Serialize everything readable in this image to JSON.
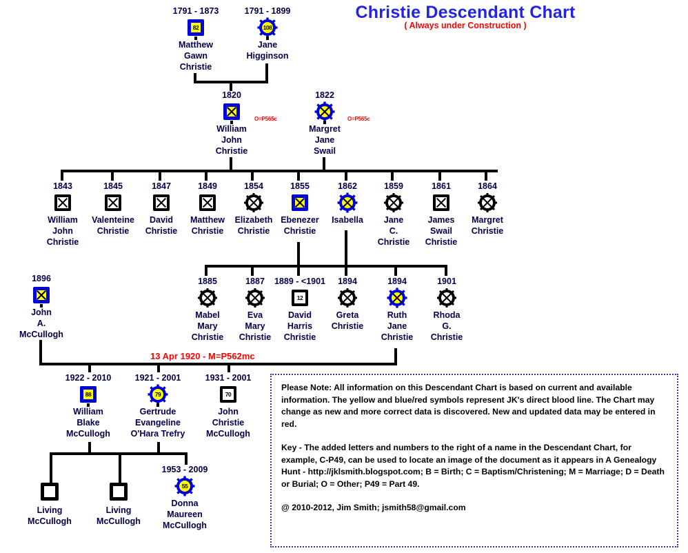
{
  "title": "Christie Descendant Chart",
  "subtitle": "( Always under Construction )",
  "generations": {
    "g1": [
      {
        "id": "matthew-gawn-christie",
        "years": "1791 - 1873",
        "name_lines": [
          "Matthew",
          "Gawn",
          "Christie"
        ],
        "symbol": "square-blue-yellow",
        "badge": "82"
      },
      {
        "id": "jane-higginson",
        "years": "1791 - 1899",
        "name_lines": [
          "Jane",
          "Higginson"
        ],
        "symbol": "circle-blue-yellow-spiked",
        "badge": "108"
      }
    ],
    "g2": [
      {
        "id": "william-john-christie",
        "years": "1820",
        "name_lines": [
          "William",
          "John",
          "Christie"
        ],
        "symbol": "square-blue-yellow-x",
        "badge": "",
        "tag": "O=P565c"
      },
      {
        "id": "margret-jane-swail",
        "years": "1822",
        "name_lines": [
          "Margret",
          "Jane",
          "Swail"
        ],
        "symbol": "circle-blue-yellow-spiked-x",
        "badge": "",
        "tag": "O=P565c"
      }
    ],
    "g3": [
      {
        "id": "william-john-christie-2",
        "years": "1843",
        "name_lines": [
          "William",
          "John",
          "Christie"
        ],
        "symbol": "square-black-x",
        "badge": ""
      },
      {
        "id": "valenteine-christie",
        "years": "1845",
        "name_lines": [
          "Valenteine",
          "Christie"
        ],
        "symbol": "square-black-x",
        "badge": ""
      },
      {
        "id": "david-christie",
        "years": "1847",
        "name_lines": [
          "David",
          "Christie"
        ],
        "symbol": "square-black-x",
        "badge": ""
      },
      {
        "id": "matthew-christie",
        "years": "1849",
        "name_lines": [
          "Matthew",
          "Christie"
        ],
        "symbol": "square-black-x",
        "badge": ""
      },
      {
        "id": "elizabeth-christie",
        "years": "1854",
        "name_lines": [
          "Elizabeth",
          "Christie"
        ],
        "symbol": "circle-black-spiked-x",
        "badge": ""
      },
      {
        "id": "ebenezer-christie",
        "years": "1855",
        "name_lines": [
          "Ebenezer",
          "Christie"
        ],
        "symbol": "square-blue-yellow-x",
        "badge": ""
      },
      {
        "id": "isabella",
        "years": "1862",
        "name_lines": [
          "Isabella"
        ],
        "symbol": "circle-blue-yellow-spiked-x",
        "badge": ""
      },
      {
        "id": "jane-c-christie",
        "years": "1859",
        "name_lines": [
          "Jane",
          "C.",
          "Christie"
        ],
        "symbol": "circle-black-spiked-x",
        "badge": ""
      },
      {
        "id": "james-swail-christie",
        "years": "1861",
        "name_lines": [
          "James",
          "Swail",
          "Christie"
        ],
        "symbol": "square-black-x",
        "badge": ""
      },
      {
        "id": "margret-christie",
        "years": "1864",
        "name_lines": [
          "Margret",
          "Christie"
        ],
        "symbol": "circle-black-spiked-x",
        "badge": ""
      }
    ],
    "g4": [
      {
        "id": "mabel-mary-christie",
        "years": "1885",
        "name_lines": [
          "Mabel",
          "Mary",
          "Christie"
        ],
        "symbol": "circle-black-spiked-x",
        "badge": ""
      },
      {
        "id": "eva-mary-christie",
        "years": "1887",
        "name_lines": [
          "Eva",
          "Mary",
          "Christie"
        ],
        "symbol": "circle-black-spiked-x",
        "badge": ""
      },
      {
        "id": "david-harris-christie",
        "years": "1889 - <1901",
        "name_lines": [
          "David",
          "Harris",
          "Christie"
        ],
        "symbol": "square-black-num",
        "badge": "12"
      },
      {
        "id": "greta-christie",
        "years": "1894",
        "name_lines": [
          "Greta",
          "Christie"
        ],
        "symbol": "circle-black-spiked-x",
        "badge": ""
      },
      {
        "id": "ruth-jane-christie",
        "years": "1894",
        "name_lines": [
          "Ruth",
          "Jane",
          "Christie"
        ],
        "symbol": "circle-blue-yellow-spiked-x",
        "badge": ""
      },
      {
        "id": "rhoda-g-christie",
        "years": "1901",
        "name_lines": [
          "Rhoda",
          "G.",
          "Christie"
        ],
        "symbol": "circle-black-spiked-x",
        "badge": ""
      }
    ],
    "spouse": {
      "id": "john-a-mccullogh",
      "years": "1896",
      "name_lines": [
        "John",
        "A.",
        "McCullogh"
      ],
      "symbol": "square-blue-yellow-x",
      "badge": ""
    },
    "marriage_note": "13 Apr 1920 - M=P562mc",
    "g5": [
      {
        "id": "william-blake-mccullogh",
        "years": "1922 - 2010",
        "name_lines": [
          "William",
          "Blake",
          "McCullogh"
        ],
        "symbol": "square-blue-yellow-num",
        "badge": "88"
      },
      {
        "id": "gertrude-evangeline-ohara-trefry",
        "years": "1921 - 2001",
        "name_lines": [
          "Gertrude",
          "Evangeline",
          "O'Hara Trefry"
        ],
        "symbol": "circle-blue-yellow-spiked-num",
        "badge": "79"
      },
      {
        "id": "john-christie-mccullogh",
        "years": "1931 - 2001",
        "name_lines": [
          "John",
          "Christie",
          "McCullogh"
        ],
        "symbol": "square-black-num",
        "badge": "70"
      }
    ],
    "g6": [
      {
        "id": "living-mccullogh-1",
        "years": "",
        "name_lines": [
          "Living",
          "McCullogh"
        ],
        "symbol": "square-black-plain",
        "badge": ""
      },
      {
        "id": "living-mccullogh-2",
        "years": "",
        "name_lines": [
          "Living",
          "McCullogh"
        ],
        "symbol": "square-black-plain",
        "badge": ""
      },
      {
        "id": "donna-maureen-mccullogh",
        "years": "1953 - 2009",
        "name_lines": [
          "Donna",
          "Maureen",
          "McCullogh"
        ],
        "symbol": "circle-blue-yellow-spiked-num",
        "badge": "55"
      }
    ]
  },
  "note_box": {
    "paragraph1": "Please Note: All information on this Descendant Chart is based on current and available information. The yellow and blue/red symbols represent JK's direct blood line.  The Chart may change as new and more correct data is discovered. New and updated data may be entered in red.",
    "paragraph2": "Key - The added letters and numbers to the right of a name in the Descendant Chart, for example, C-P49, can be used to locate an image of the document as  it appears in A Genealogy Hunt - http://jklsmith.blogspot.com; B = Birth; C = Baptism/Christening; M = Marriage; D = Death or Burial;  O = Other; P49 = Part 49.",
    "credit": "@ 2010-2012, Jim Smith; jsmith58@gmail.com"
  },
  "colors": {
    "title_blue": "#2323e6",
    "red": "#ff0000",
    "name_navy": "#00004d",
    "symbol_blue": "#0000d8",
    "symbol_yellow": "#ffff00",
    "note_border": "#3333cc"
  }
}
